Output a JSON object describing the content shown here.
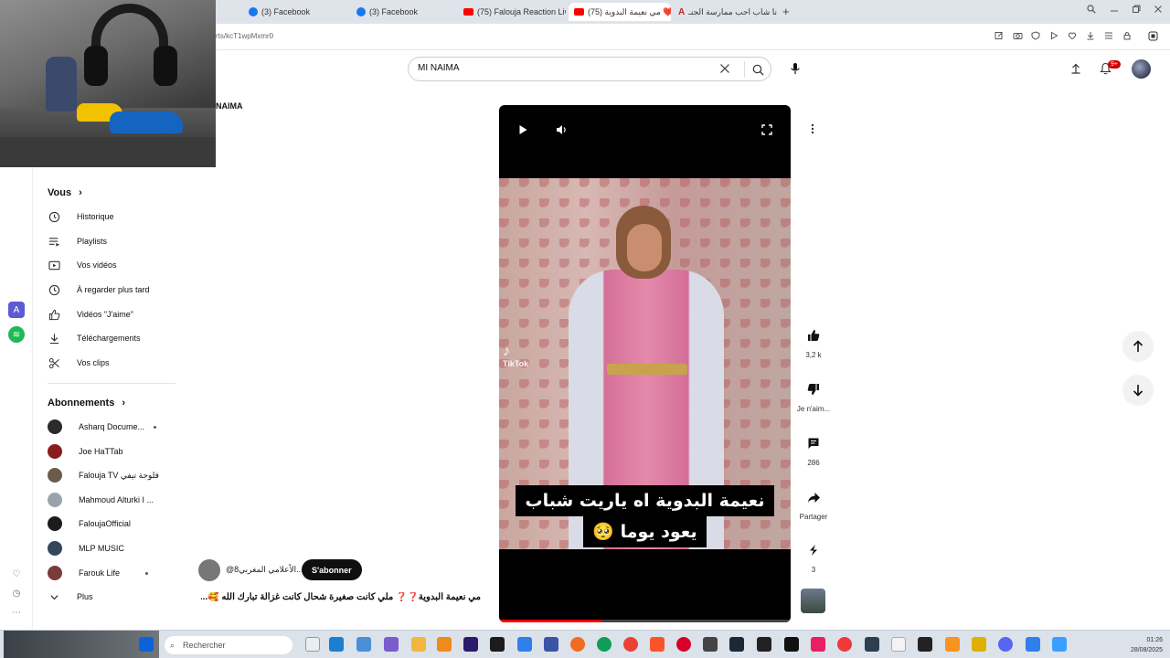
{
  "browser": {
    "tabs": [
      {
        "label": "(3) Facebook",
        "icon": "facebook-icon"
      },
      {
        "label": "(3) Facebook",
        "icon": "facebook-icon"
      },
      {
        "label": "(75) Falouja Reaction Live",
        "icon": "youtube-icon"
      },
      {
        "label": "(75) مي نعيمة البدوية ❤️❤️",
        "icon": "youtube-icon"
      },
      {
        "label": "انا شاب احب ممارسة الجنـ",
        "icon": "a-icon"
      }
    ],
    "new_tab": "+",
    "url": "rts/kcT1wpMxmr0"
  },
  "search": {
    "value": "MI NAIMA"
  },
  "notifications": {
    "badge": "9+"
  },
  "page_crumb": "NAIMA",
  "sidebar": {
    "you": {
      "title": "Vous",
      "chevron": "›"
    },
    "you_items": [
      {
        "label": "Historique",
        "icon": "history-icon"
      },
      {
        "label": "Playlists",
        "icon": "playlists-icon"
      },
      {
        "label": "Vos vidéos",
        "icon": "your-videos-icon"
      },
      {
        "label": "À regarder plus tard",
        "icon": "watch-later-icon"
      },
      {
        "label": "Vidéos \"J'aime\"",
        "icon": "liked-icon"
      },
      {
        "label": "Téléchargements",
        "icon": "download-icon"
      },
      {
        "label": "Vos clips",
        "icon": "clips-icon"
      }
    ],
    "subs": {
      "title": "Abonnements",
      "chevron": "›"
    },
    "sub_items": [
      {
        "label": "Asharq Docume...",
        "color": "#2b2b2b",
        "dot": true
      },
      {
        "label": "Joe HaTTab",
        "color": "#8b1c1c",
        "dot": false
      },
      {
        "label": "Falouja TV فلوجة تيفي",
        "color": "#6d5b49",
        "dot": false
      },
      {
        "label": "Mahmoud Alturki I ...",
        "color": "#9aa3ad",
        "dot": false
      },
      {
        "label": "FaloujaOfficial",
        "color": "#1b1b1b",
        "dot": false
      },
      {
        "label": "MLP MUSIC",
        "color": "#33475b",
        "dot": false
      },
      {
        "label": "Farouk Life",
        "color": "#7a3b3b",
        "dot": true
      }
    ],
    "more": "Plus"
  },
  "player": {
    "watermark": "TikTok",
    "caption_line1": "نعيمة البدوية اه ياريت شباب",
    "caption_line2": "يعود يوما 🥺",
    "progress": 0.35
  },
  "actions": {
    "like": {
      "label": "3,2 k",
      "icon": "thumbs-up-icon"
    },
    "dislike": {
      "label": "Je n'aim...",
      "icon": "thumbs-down-icon"
    },
    "comments": {
      "label": "286",
      "icon": "comment-icon"
    },
    "share": {
      "label": "Partager",
      "icon": "share-icon"
    },
    "remix": {
      "label": "3",
      "icon": "remix-icon"
    }
  },
  "channel": {
    "name": "@الاًعلامي المغربي8...",
    "subscribe_label": "S'abonner"
  },
  "video_title": "مي نعيمة البدوية❓❓ ملي كانت صغيرة شحال كانت غزالة تبارك الله 🥰...",
  "taskbar": {
    "search_placeholder": "Rechercher",
    "time": "01:26",
    "date": "28/08/2025"
  },
  "colors": {
    "accent_red": "#ff0000",
    "badge_red": "#cc0000",
    "subscribe_bg": "#0f0f0f"
  }
}
